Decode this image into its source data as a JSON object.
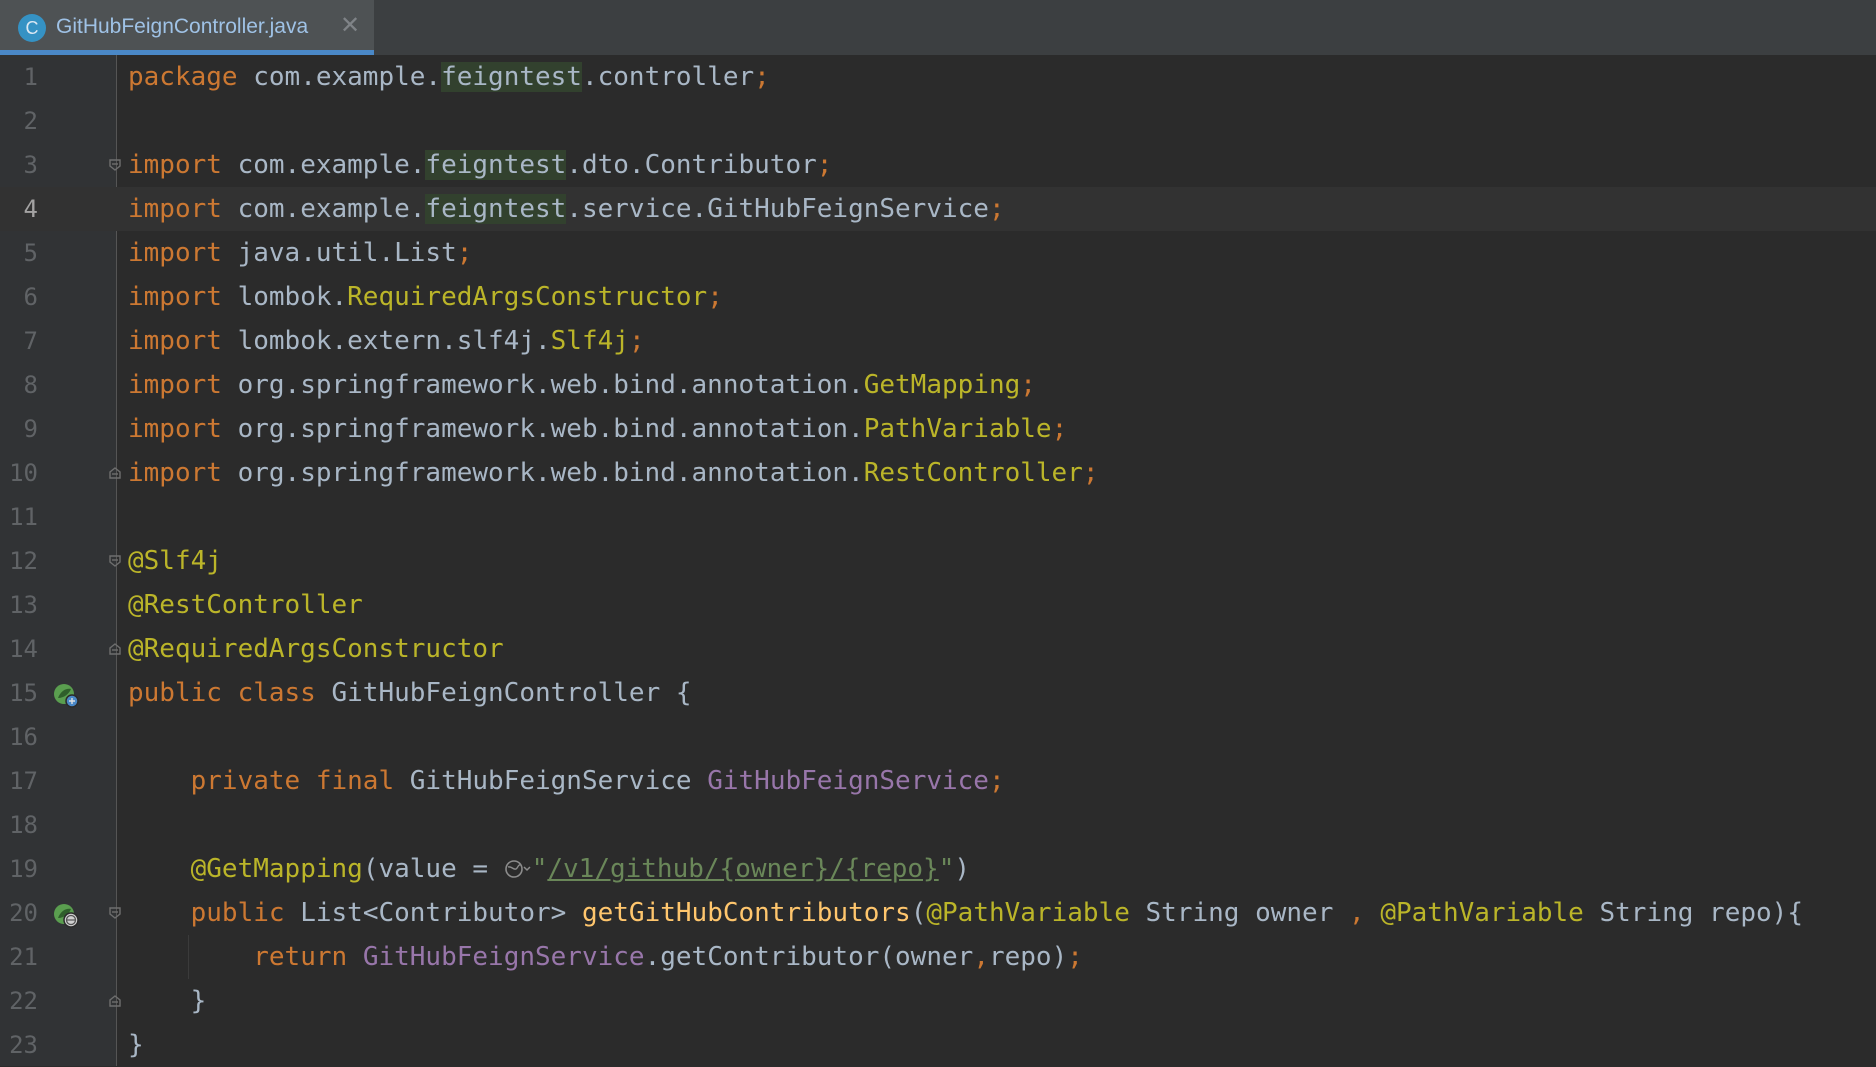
{
  "tab": {
    "icon_letter": "C",
    "title": "GitHubFeignController.java",
    "close_glyph": "✕"
  },
  "editor": {
    "current_line": 4,
    "line_numbers": [
      "1",
      "2",
      "3",
      "4",
      "5",
      "6",
      "7",
      "8",
      "9",
      "10",
      "11",
      "12",
      "13",
      "14",
      "15",
      "16",
      "17",
      "18",
      "19",
      "20",
      "21",
      "22",
      "23"
    ],
    "code": {
      "l1": [
        "package",
        " com.example.",
        "feigntest",
        ".controller",
        ";"
      ],
      "l3": [
        "import",
        " com.example.",
        "feigntest",
        ".dto.Contributor",
        ";"
      ],
      "l4": [
        "import",
        " com.example.",
        "feigntest",
        ".service.GitHubFeignService",
        ";"
      ],
      "l5": [
        "import",
        " java.util.List",
        ";"
      ],
      "l6": [
        "import",
        " lombok.",
        "RequiredArgsConstructor",
        ";"
      ],
      "l7": [
        "import",
        " lombok.extern.slf4j.",
        "Slf4j",
        ";"
      ],
      "l8": [
        "import",
        " org.springframework.web.bind.annotation.",
        "GetMapping",
        ";"
      ],
      "l9": [
        "import",
        " org.springframework.web.bind.annotation.",
        "PathVariable",
        ";"
      ],
      "l10": [
        "import",
        " org.springframework.web.bind.annotation.",
        "RestController",
        ";"
      ],
      "l12": [
        "@Slf4j"
      ],
      "l13": [
        "@RestController"
      ],
      "l14": [
        "@RequiredArgsConstructor"
      ],
      "l15": [
        "public class",
        " GitHubFeignController {"
      ],
      "l17": [
        "    ",
        "private final",
        " GitHubFeignService ",
        "GitHubFeignService",
        ";"
      ],
      "l19": [
        "    ",
        "@GetMapping",
        "(value = ",
        "\"",
        "/v1/github/{owner}/{repo}",
        "\"",
        ")"
      ],
      "l20": [
        "    ",
        "public",
        " List<Contributor> ",
        "getGitHubContributors",
        "(",
        "@PathVariable",
        " String owner ",
        ",",
        " ",
        "@PathVariable",
        " String repo){"
      ],
      "l21": [
        "        ",
        "return",
        " ",
        "GitHubFeignService",
        ".getContributor(owner",
        ",",
        "repo)",
        ";"
      ],
      "l22": [
        "    }"
      ],
      "l23": [
        "}"
      ]
    }
  },
  "colors": {
    "keyword": "#cc7832",
    "annotation": "#bbb529",
    "field": "#9876aa",
    "string": "#6a8759",
    "method": "#ffc66d",
    "text": "#a9b7c6",
    "background": "#2b2b2b"
  },
  "icons": {
    "fold_markers": [
      "fold-start-icon",
      "fold-end-icon"
    ],
    "gutter_markers": [
      "spring-bean-icon",
      "spring-endpoint-icon"
    ],
    "inline": "globe-dropdown-icon"
  }
}
